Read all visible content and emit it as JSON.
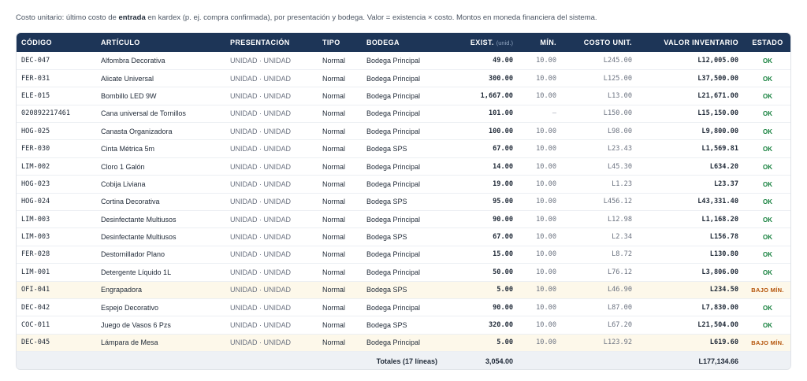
{
  "caption": {
    "part1": "Costo unitario: último costo de ",
    "bold": "entrada",
    "part2": " en kardex (p. ej. compra confirmada), por presentación y bodega. Valor = existencia × costo. Montos en moneda financiera del sistema."
  },
  "columns": {
    "codigo": "CÓDIGO",
    "articulo": "ARTÍCULO",
    "presentacion": "PRESENTACIÓN",
    "tipo": "TIPO",
    "bodega": "BODEGA",
    "exist": "EXIST.",
    "exist_unit": "(unid.)",
    "min": "MÍN.",
    "costo": "COSTO UNIT.",
    "valor": "VALOR INVENTARIO",
    "estado": "ESTADO"
  },
  "rows": [
    {
      "codigo": "DEC-047",
      "articulo": "Alfombra Decorativa",
      "presentacion": "UNIDAD · UNIDAD",
      "tipo": "Normal",
      "bodega": "Bodega Principal",
      "exist": "49.00",
      "min": "10.00",
      "costo": "L245.00",
      "valor": "L12,005.00",
      "estado": "OK",
      "low": false
    },
    {
      "codigo": "FER-031",
      "articulo": "Alicate Universal",
      "presentacion": "UNIDAD · UNIDAD",
      "tipo": "Normal",
      "bodega": "Bodega Principal",
      "exist": "300.00",
      "min": "10.00",
      "costo": "L125.00",
      "valor": "L37,500.00",
      "estado": "OK",
      "low": false
    },
    {
      "codigo": "ELE-015",
      "articulo": "Bombillo LED 9W",
      "presentacion": "UNIDAD · UNIDAD",
      "tipo": "Normal",
      "bodega": "Bodega Principal",
      "exist": "1,667.00",
      "min": "10.00",
      "costo": "L13.00",
      "valor": "L21,671.00",
      "estado": "OK",
      "low": false
    },
    {
      "codigo": "020892217461",
      "articulo": "Cana universal de Tornillos",
      "presentacion": "UNIDAD · UNIDAD",
      "tipo": "Normal",
      "bodega": "Bodega Principal",
      "exist": "101.00",
      "min": "—",
      "costo": "L150.00",
      "valor": "L15,150.00",
      "estado": "OK",
      "low": false
    },
    {
      "codigo": "HOG-025",
      "articulo": "Canasta Organizadora",
      "presentacion": "UNIDAD · UNIDAD",
      "tipo": "Normal",
      "bodega": "Bodega Principal",
      "exist": "100.00",
      "min": "10.00",
      "costo": "L98.00",
      "valor": "L9,800.00",
      "estado": "OK",
      "low": false
    },
    {
      "codigo": "FER-030",
      "articulo": "Cinta Métrica 5m",
      "presentacion": "UNIDAD · UNIDAD",
      "tipo": "Normal",
      "bodega": "Bodega SPS",
      "exist": "67.00",
      "min": "10.00",
      "costo": "L23.43",
      "valor": "L1,569.81",
      "estado": "OK",
      "low": false
    },
    {
      "codigo": "LIM-002",
      "articulo": "Cloro 1 Galón",
      "presentacion": "UNIDAD · UNIDAD",
      "tipo": "Normal",
      "bodega": "Bodega Principal",
      "exist": "14.00",
      "min": "10.00",
      "costo": "L45.30",
      "valor": "L634.20",
      "estado": "OK",
      "low": false
    },
    {
      "codigo": "HOG-023",
      "articulo": "Cobija Liviana",
      "presentacion": "UNIDAD · UNIDAD",
      "tipo": "Normal",
      "bodega": "Bodega Principal",
      "exist": "19.00",
      "min": "10.00",
      "costo": "L1.23",
      "valor": "L23.37",
      "estado": "OK",
      "low": false
    },
    {
      "codigo": "HOG-024",
      "articulo": "Cortina Decorativa",
      "presentacion": "UNIDAD · UNIDAD",
      "tipo": "Normal",
      "bodega": "Bodega SPS",
      "exist": "95.00",
      "min": "10.00",
      "costo": "L456.12",
      "valor": "L43,331.40",
      "estado": "OK",
      "low": false
    },
    {
      "codigo": "LIM-003",
      "articulo": "Desinfectante Multiusos",
      "presentacion": "UNIDAD · UNIDAD",
      "tipo": "Normal",
      "bodega": "Bodega Principal",
      "exist": "90.00",
      "min": "10.00",
      "costo": "L12.98",
      "valor": "L1,168.20",
      "estado": "OK",
      "low": false
    },
    {
      "codigo": "LIM-003",
      "articulo": "Desinfectante Multiusos",
      "presentacion": "UNIDAD · UNIDAD",
      "tipo": "Normal",
      "bodega": "Bodega SPS",
      "exist": "67.00",
      "min": "10.00",
      "costo": "L2.34",
      "valor": "L156.78",
      "estado": "OK",
      "low": false
    },
    {
      "codigo": "FER-028",
      "articulo": "Destornillador Plano",
      "presentacion": "UNIDAD · UNIDAD",
      "tipo": "Normal",
      "bodega": "Bodega Principal",
      "exist": "15.00",
      "min": "10.00",
      "costo": "L8.72",
      "valor": "L130.80",
      "estado": "OK",
      "low": false
    },
    {
      "codigo": "LIM-001",
      "articulo": "Detergente Líquido 1L",
      "presentacion": "UNIDAD · UNIDAD",
      "tipo": "Normal",
      "bodega": "Bodega Principal",
      "exist": "50.00",
      "min": "10.00",
      "costo": "L76.12",
      "valor": "L3,806.00",
      "estado": "OK",
      "low": false
    },
    {
      "codigo": "OFI-041",
      "articulo": "Engrapadora",
      "presentacion": "UNIDAD · UNIDAD",
      "tipo": "Normal",
      "bodega": "Bodega SPS",
      "exist": "5.00",
      "min": "10.00",
      "costo": "L46.90",
      "valor": "L234.50",
      "estado": "BAJO MÍN.",
      "low": true
    },
    {
      "codigo": "DEC-042",
      "articulo": "Espejo Decorativo",
      "presentacion": "UNIDAD · UNIDAD",
      "tipo": "Normal",
      "bodega": "Bodega Principal",
      "exist": "90.00",
      "min": "10.00",
      "costo": "L87.00",
      "valor": "L7,830.00",
      "estado": "OK",
      "low": false
    },
    {
      "codigo": "COC-011",
      "articulo": "Juego de Vasos 6 Pzs",
      "presentacion": "UNIDAD · UNIDAD",
      "tipo": "Normal",
      "bodega": "Bodega SPS",
      "exist": "320.00",
      "min": "10.00",
      "costo": "L67.20",
      "valor": "L21,504.00",
      "estado": "OK",
      "low": false
    },
    {
      "codigo": "DEC-045",
      "articulo": "Lámpara de Mesa",
      "presentacion": "UNIDAD · UNIDAD",
      "tipo": "Normal",
      "bodega": "Bodega Principal",
      "exist": "5.00",
      "min": "10.00",
      "costo": "L123.92",
      "valor": "L619.60",
      "estado": "BAJO MÍN.",
      "low": true
    }
  ],
  "totals": {
    "label": "Totales (17 líneas)",
    "exist": "3,054.00",
    "valor": "L177,134.66"
  },
  "colors": {
    "header_bg": "#1d3557",
    "ok": "#15803d",
    "low": "#b45309",
    "low_row_bg": "#fdf8ea"
  }
}
